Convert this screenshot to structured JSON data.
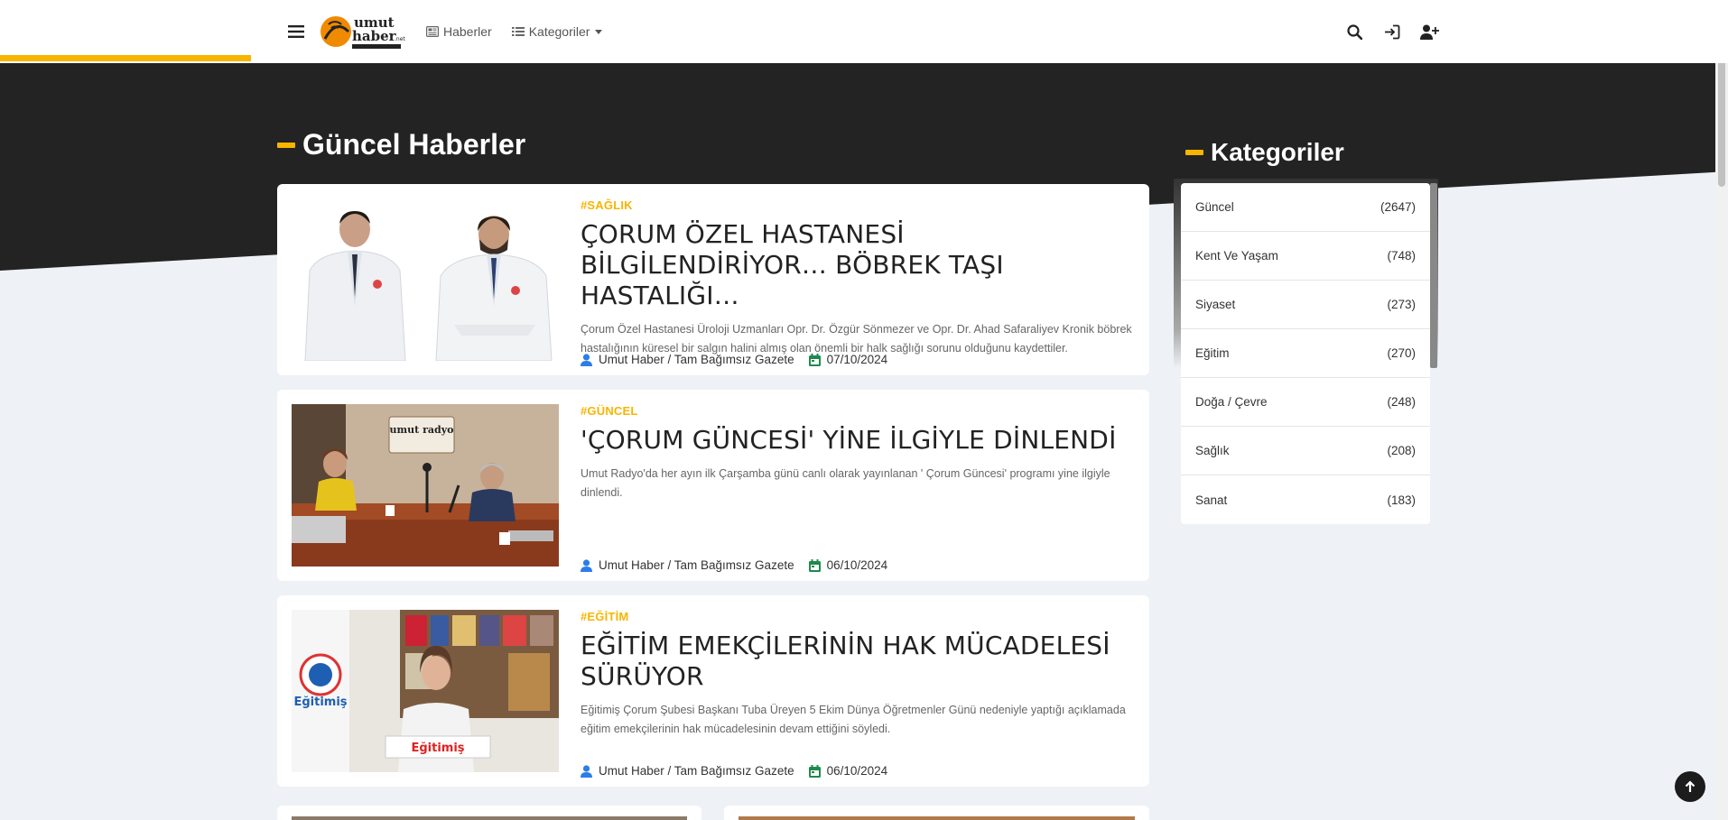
{
  "brand": {
    "logo_text": "umut haber.net",
    "logo_tagline": "Tam Bağımsız Gazete",
    "accent": "#f7b500",
    "dark": "#232323"
  },
  "nav": {
    "links": [
      {
        "label": "Haberler",
        "icon": "newspaper-icon"
      },
      {
        "label": "Kategoriler",
        "icon": "list-icon"
      }
    ],
    "right_icons": [
      "search-icon",
      "login-icon",
      "user-plus-icon"
    ]
  },
  "main": {
    "section_title": "Güncel Haberler",
    "news": [
      {
        "category": "#SAĞLIK",
        "title": "ÇORUM ÖZEL HASTANESİ BİLGİLENDİRİYOR… BÖBREK TAŞI HASTALIĞI…",
        "description": "Çorum Özel Hastanesi Üroloji Uzmanları Opr. Dr. Özgür Sönmezer ve Opr. Dr. Ahad Safaraliyev Kronik böbrek hastalığının küresel bir salgın halini almış olan önemli bir halk sağlığı sorunu olduğunu kaydettiler.",
        "author": "Umut Haber / Tam Bağımsız Gazete",
        "date": "07/10/2024"
      },
      {
        "category": "#GÜNCEL",
        "title": "'ÇORUM GÜNCESİ' YİNE İLGİYLE DİNLENDİ",
        "description": "Umut Radyo'da her ayın ilk Çarşamba günü canlı olarak yayınlanan ' Çorum Güncesi' programı yine ilgiyle dinlendi.",
        "author": "Umut Haber / Tam Bağımsız Gazete",
        "date": "06/10/2024"
      },
      {
        "category": "#EĞİTİM",
        "title": "EĞİTİM EMEKÇİLERİNİN HAK MÜCADELESİ SÜRÜYOR",
        "description": "Eğitimiş Çorum Şubesi Başkanı Tuba Üreyen 5 Ekim Dünya Öğretmenler Günü nedeniyle yaptığı açıklamada eğitim emekçilerinin hak mücadelesinin devam ettiğini söyledi.",
        "author": "Umut Haber / Tam Bağımsız Gazete",
        "date": "06/10/2024"
      }
    ]
  },
  "sidebar": {
    "title": "Kategoriler",
    "categories": [
      {
        "name": "Güncel",
        "count": "(2647)"
      },
      {
        "name": "Kent Ve Yaşam",
        "count": "(748)"
      },
      {
        "name": "Siyaset",
        "count": "(273)"
      },
      {
        "name": "Eğitim",
        "count": "(270)"
      },
      {
        "name": "Doğa / Çevre",
        "count": "(248)"
      },
      {
        "name": "Sağlık",
        "count": "(208)"
      },
      {
        "name": "Sanat",
        "count": "(183)"
      }
    ]
  },
  "photo_texts": {
    "radio_sign": "umut radyo",
    "sign_egitimis": "Eğitimiş",
    "desk_egitimis": "Eğitimiş"
  }
}
